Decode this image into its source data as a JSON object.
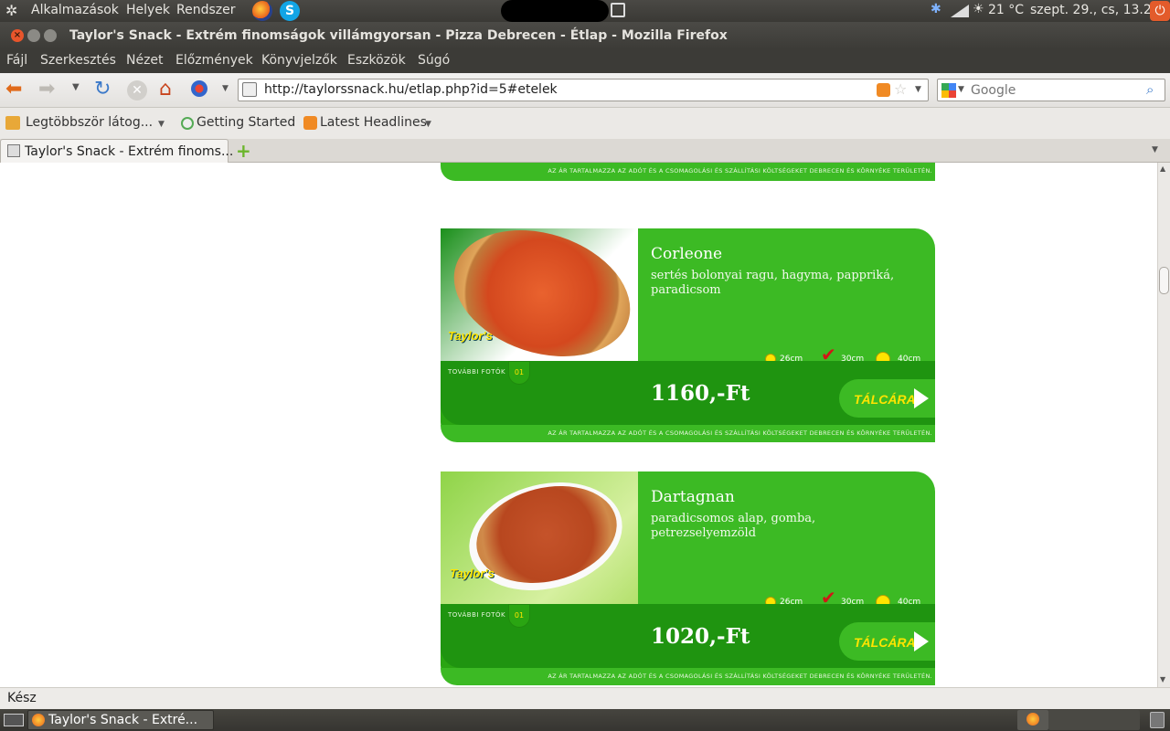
{
  "top_panel": {
    "menus": [
      "Alkalmazások",
      "Helyek",
      "Rendszer"
    ],
    "temperature": "21 °C",
    "datetime": "szept. 29., cs, 13.28"
  },
  "window": {
    "title": "Taylor's Snack - Extrém finomságok villámgyorsan - Pizza Debrecen - Étlap - Mozilla Firefox"
  },
  "menubar": [
    "Fájl",
    "Szerkesztés",
    "Nézet",
    "Előzmények",
    "Könyvjelzők",
    "Eszközök",
    "Súgó"
  ],
  "navbar": {
    "url": "http://taylorssnack.hu/etlap.php?id=5#etelek",
    "search_placeholder": "Google"
  },
  "bookmarks": [
    "Legtöbbször látog...",
    "Getting Started",
    "Latest Headlines"
  ],
  "tab": {
    "label": "Taylor's Snack - Extrém finoms..."
  },
  "page": {
    "disclaimer": "AZ ÁR TARTALMAZZA AZ ADÓT ÉS A CSOMAGOLÁSI ÉS SZÁLLÍTÁSI KÖLTSÉGEKET DEBRECEN ÉS KÖRNYÉKE TERÜLETÉN.",
    "more_photos": "TOVÁBBI FOTÓK",
    "cart_label": "TÁLCÁRA",
    "sizes": [
      "26cm",
      "30cm",
      "40cm"
    ],
    "selected_size": "30cm",
    "pizzas": [
      {
        "name": "Corleone",
        "desc": "sertés bolonyai ragu, hagyma, pappriká, paradicsom",
        "price": "1160,-Ft",
        "photo_count": "01"
      },
      {
        "name": "Dartagnan",
        "desc": "paradicsomos alap, gomba, petrezselyemzöld",
        "price": "1020,-Ft",
        "photo_count": "01"
      }
    ],
    "logo_text": "Taylor's"
  },
  "statusbar": {
    "text": "Kész"
  },
  "taskbar": {
    "item": "Taylor's Snack - Extré..."
  },
  "colors": {
    "card_green": "#3cba24",
    "dark_green": "#1f9410",
    "yellow": "#ffe400"
  }
}
